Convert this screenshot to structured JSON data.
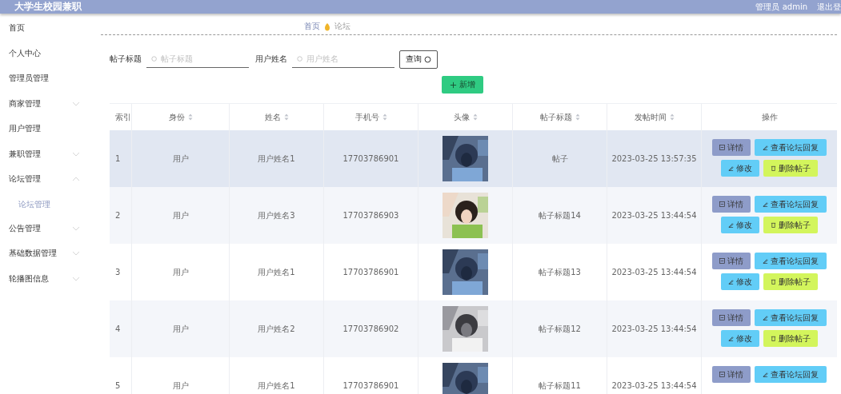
{
  "header": {
    "title": "大学生校园兼职",
    "user": "管理员 admin",
    "logout": "退出登"
  },
  "sidebar": {
    "items": [
      {
        "label": "首页",
        "selected": false
      },
      {
        "label": "个人中心",
        "selected": false
      },
      {
        "label": "管理员管理",
        "selected": false
      },
      {
        "label": "商家管理",
        "selected": false,
        "expanded": false
      },
      {
        "label": "用户管理",
        "selected": false
      },
      {
        "label": "兼职管理",
        "selected": false,
        "expanded": false
      },
      {
        "label": "论坛管理",
        "selected": false,
        "expanded": true,
        "children": [
          {
            "label": "论坛管理",
            "selected": true
          }
        ]
      },
      {
        "label": "公告管理",
        "selected": false,
        "expanded": false
      },
      {
        "label": "基础数据管理",
        "selected": false,
        "expanded": false
      },
      {
        "label": "轮播图信息",
        "selected": false,
        "expanded": false
      }
    ]
  },
  "breadcrumb": [
    "首页",
    "论坛"
  ],
  "search": {
    "fields": [
      {
        "label": "帖子标题",
        "placeholder": "帖子标题"
      },
      {
        "label": "用户姓名",
        "placeholder": "用户姓名"
      }
    ],
    "query_button": "查询",
    "add_button": "新增"
  },
  "table": {
    "columns": [
      {
        "label": "索引",
        "sortable": false
      },
      {
        "label": "身份",
        "sortable": true
      },
      {
        "label": "姓名",
        "sortable": true
      },
      {
        "label": "手机号",
        "sortable": true
      },
      {
        "label": "头像",
        "sortable": true
      },
      {
        "label": "帖子标题",
        "sortable": true
      },
      {
        "label": "发帖时间",
        "sortable": true
      },
      {
        "label": "操作",
        "sortable": false
      }
    ],
    "rows": [
      {
        "index": "1",
        "role": "用户",
        "name": "用户姓名1",
        "phone": "17703786901",
        "avatar": {
          "kind": "picture"
        },
        "title": "帖子",
        "time": "2023-03-25 13:57:35",
        "hovered": true,
        "actions": [
          {
            "kind": "detail",
            "label": "详情"
          },
          {
            "kind": "replies",
            "label": "查看论坛回复"
          },
          {
            "kind": "edit",
            "label": "修改"
          },
          {
            "kind": "delete",
            "label": "删除帖子"
          }
        ]
      },
      {
        "index": "2",
        "role": "用户",
        "name": "用户姓名3",
        "phone": "17703786903",
        "avatar": {
          "kind": "picture"
        },
        "title": "帖子标题14",
        "time": "2023-03-25 13:44:54",
        "hovered": false,
        "actions": [
          {
            "kind": "detail",
            "label": "详情"
          },
          {
            "kind": "replies",
            "label": "查看论坛回复"
          },
          {
            "kind": "edit",
            "label": "修改"
          },
          {
            "kind": "delete",
            "label": "删除帖子"
          }
        ]
      },
      {
        "index": "3",
        "role": "用户",
        "name": "用户姓名1",
        "phone": "17703786901",
        "avatar": {
          "kind": "picture"
        },
        "title": "帖子标题13",
        "time": "2023-03-25 13:44:54",
        "hovered": false,
        "actions": [
          {
            "kind": "detail",
            "label": "详情"
          },
          {
            "kind": "replies",
            "label": "查看论坛回复"
          },
          {
            "kind": "edit",
            "label": "修改"
          },
          {
            "kind": "delete",
            "label": "删除帖子"
          }
        ]
      },
      {
        "index": "4",
        "role": "用户",
        "name": "用户姓名2",
        "phone": "17703786902",
        "avatar": {
          "kind": "picture"
        },
        "title": "帖子标题12",
        "time": "2023-03-25 13:44:54",
        "hovered": false,
        "actions": [
          {
            "kind": "detail",
            "label": "详情"
          },
          {
            "kind": "replies",
            "label": "查看论坛回复"
          },
          {
            "kind": "edit",
            "label": "修改"
          },
          {
            "kind": "delete",
            "label": "删除帖子"
          }
        ]
      },
      {
        "index": "5",
        "role": "用户",
        "name": "用户姓名1",
        "phone": "17703786901",
        "avatar": {
          "kind": "picture"
        },
        "title": "帖子标题11",
        "time": "2023-03-25 13:44:54",
        "hovered": false,
        "actions": [
          {
            "kind": "detail",
            "label": "详情"
          },
          {
            "kind": "replies",
            "label": "查看论坛回复"
          }
        ]
      }
    ]
  }
}
